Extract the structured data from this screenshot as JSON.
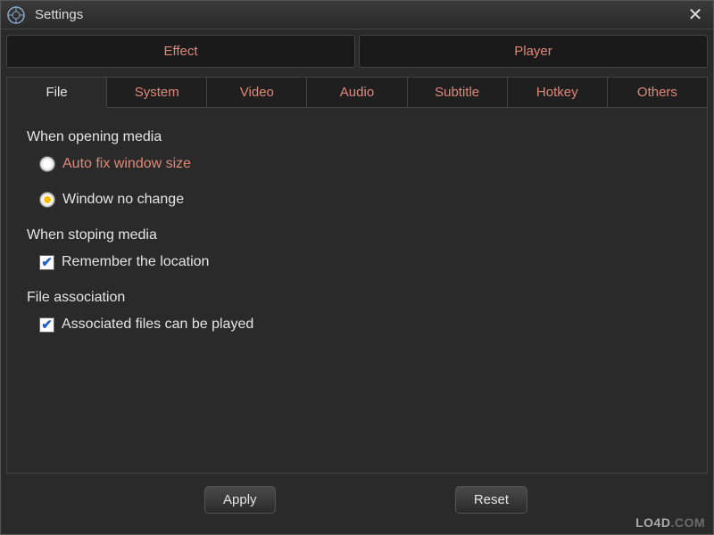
{
  "window": {
    "title": "Settings"
  },
  "main_tabs": {
    "effect": "Effect",
    "player": "Player",
    "active": "player"
  },
  "sub_tabs": {
    "items": [
      "File",
      "System",
      "Video",
      "Audio",
      "Subtitle",
      "Hotkey",
      "Others"
    ],
    "active": "File"
  },
  "sections": {
    "opening": {
      "heading": "When opening media",
      "opt_autofix": "Auto fix window size",
      "opt_nochange": "Window no change",
      "selected": "nochange"
    },
    "stopping": {
      "heading": "When stoping media",
      "opt_remember": "Remember the location",
      "checked_remember": true
    },
    "association": {
      "heading": "File association",
      "opt_assoc": "Associated files can be played",
      "checked_assoc": true
    }
  },
  "buttons": {
    "apply": "Apply",
    "reset": "Reset"
  },
  "watermark": {
    "brand": "LO4D",
    "suffix": ".COM"
  }
}
